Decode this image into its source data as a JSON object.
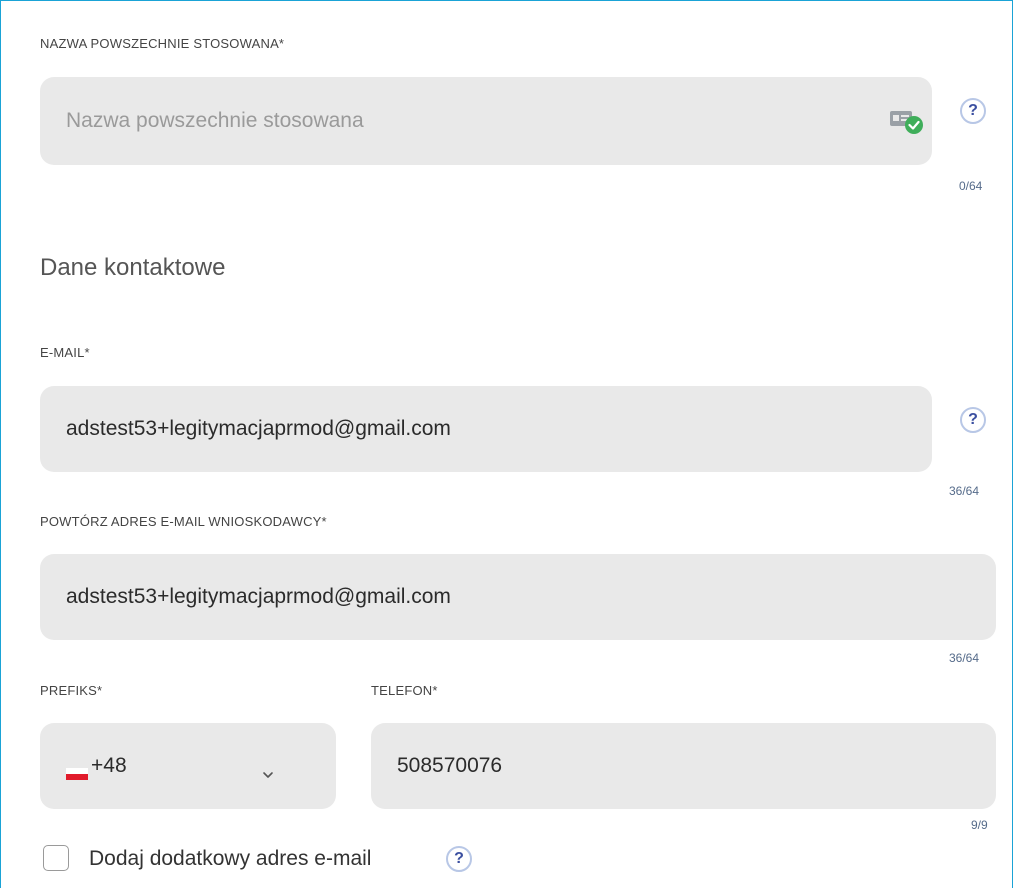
{
  "common_name": {
    "label": "NAZWA POWSZECHNIE STOSOWANA*",
    "placeholder": "Nazwa powszechnie stosowana",
    "counter": "0/64",
    "icon": "id-card-verified-icon",
    "help": "?"
  },
  "section": {
    "title": "Dane kontaktowe"
  },
  "email": {
    "label": "E-MAIL*",
    "value": "adstest53+legitymacjaprmod@gmail.com",
    "counter": "36/64",
    "help": "?"
  },
  "email_repeat": {
    "label": "POWTÓRZ ADRES E-MAIL WNIOSKODAWCY*",
    "value": "adstest53+legitymacjaprmod@gmail.com",
    "counter": "36/64"
  },
  "prefix": {
    "label": "PREFIKS*",
    "value": "+48",
    "flag": "poland-flag-icon"
  },
  "phone": {
    "label": "TELEFON*",
    "value": "508570076",
    "counter": "9/9"
  },
  "extra_email": {
    "label": "Dodaj dodatkowy adres e-mail",
    "help": "?"
  },
  "colors": {
    "accent_border": "#1aa3d6",
    "field_bg": "#e9e9e9",
    "help_border": "#b8c7e6",
    "help_text": "#3b4fa0",
    "verified_green": "#3fae5a"
  }
}
